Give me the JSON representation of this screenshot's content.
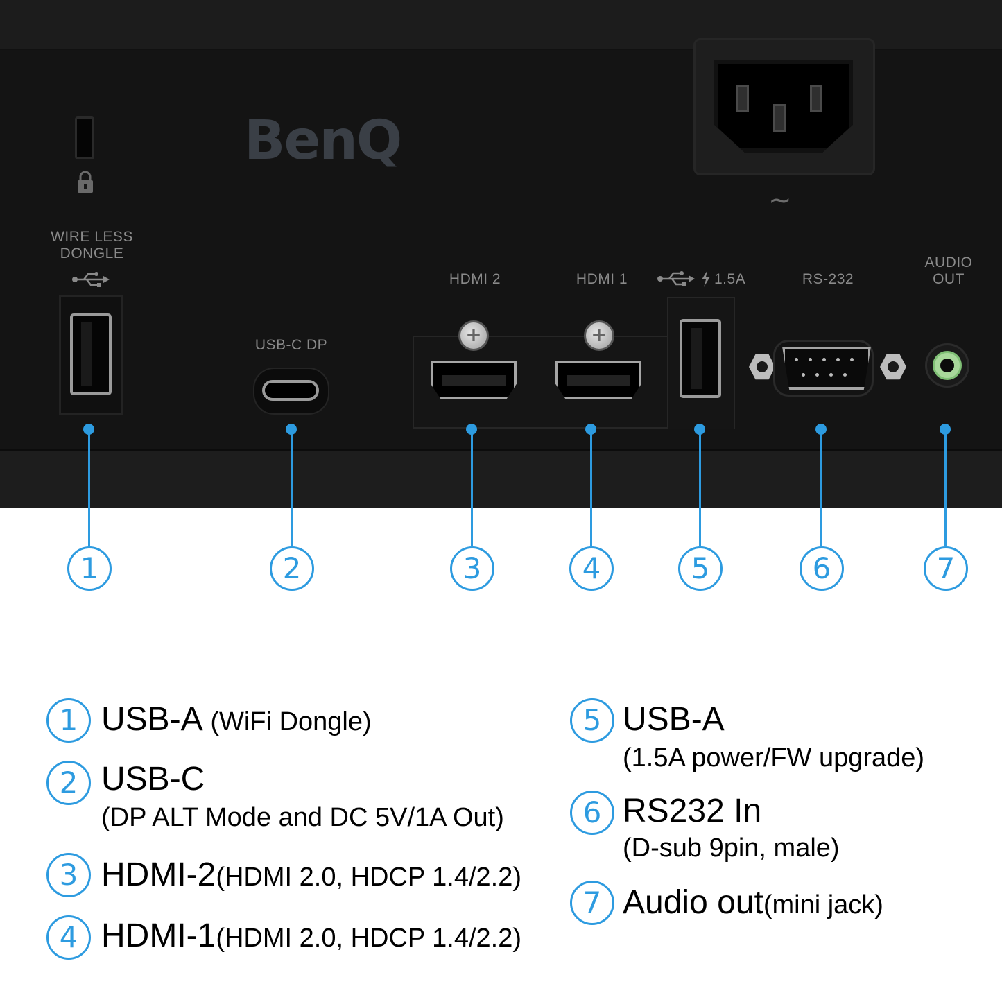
{
  "brand": "BenQ",
  "power": {
    "ac_symbol": "~"
  },
  "ports": {
    "wireless_dongle": {
      "label_line1": "WIRE LESS",
      "label_line2": "DONGLE"
    },
    "usbc": {
      "label": "USB-C DP"
    },
    "hdmi2": {
      "label": "HDMI 2"
    },
    "hdmi1": {
      "label": "HDMI 1"
    },
    "usb_power": {
      "label": "1.5A"
    },
    "rs232": {
      "label": "RS-232"
    },
    "audio": {
      "label_line1": "AUDIO",
      "label_line2": "OUT"
    }
  },
  "callouts": [
    "1",
    "2",
    "3",
    "4",
    "5",
    "6",
    "7"
  ],
  "legend": [
    {
      "num": "1",
      "title": "USB-A",
      "detail": "(WiFi Dongle)"
    },
    {
      "num": "2",
      "title": "USB-C",
      "detail": "(DP ALT Mode and DC 5V/1A Out)"
    },
    {
      "num": "3",
      "title": "HDMI-2",
      "detail": "(HDMI 2.0, HDCP 1.4/2.2)"
    },
    {
      "num": "4",
      "title": "HDMI-1",
      "detail": "(HDMI 2.0, HDCP 1.4/2.2)"
    },
    {
      "num": "5",
      "title": "USB-A",
      "detail": "(1.5A power/FW upgrade)"
    },
    {
      "num": "6",
      "title": "RS232 In",
      "detail": "(D-sub 9pin, male)"
    },
    {
      "num": "7",
      "title": "Audio out",
      "detail": "(mini jack)"
    }
  ],
  "colors": {
    "accent": "#2d9be0",
    "panel": "#141414",
    "label_grey": "#8a8a8a"
  },
  "icons": [
    "lock-icon",
    "usb-icon",
    "usb-icon",
    "lightning-icon"
  ]
}
